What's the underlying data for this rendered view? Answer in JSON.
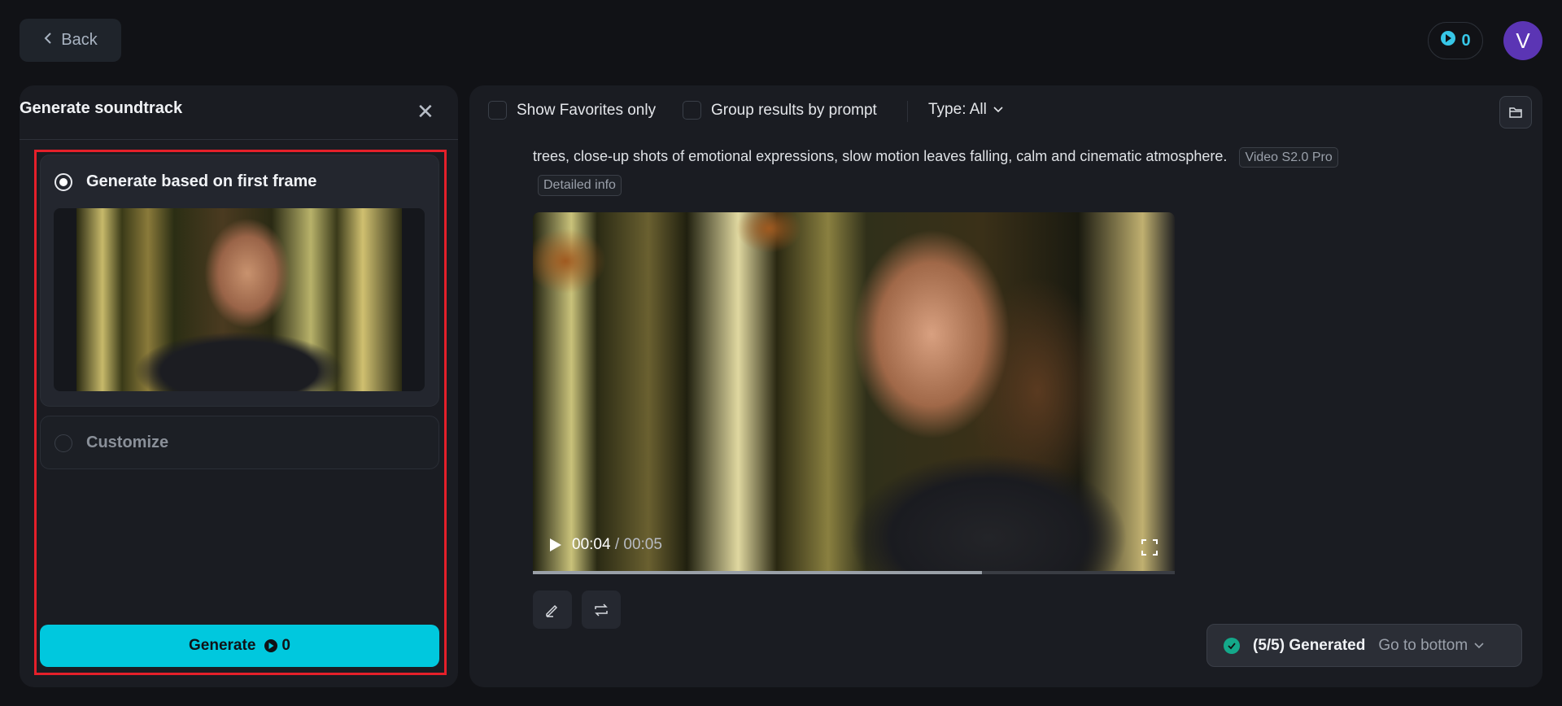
{
  "header": {
    "back_label": "Back",
    "credits": "0",
    "avatar_letter": "V"
  },
  "left_panel": {
    "title": "Generate soundtrack",
    "options": [
      {
        "label": "Generate based on first frame",
        "selected": true
      },
      {
        "label": "Customize",
        "selected": false
      }
    ],
    "generate_label": "Generate",
    "generate_cost": "0"
  },
  "toolbar": {
    "favorites_label": "Show Favorites only",
    "group_label": "Group results by prompt",
    "type_label": "Type: All"
  },
  "result": {
    "prompt": "trees, close-up shots of emotional expressions, slow motion leaves falling, calm and cinematic atmosphere.",
    "model_tag": "Video S2.0 Pro",
    "detail_label": "Detailed info",
    "current_time": "00:04",
    "duration": "/ 00:05",
    "progress": 0.7
  },
  "status": {
    "generated": "(5/5) Generated",
    "goto": "Go to bottom"
  },
  "colors": {
    "accent": "#00c8de",
    "avatar": "#5b35b4",
    "success": "#14a88a"
  }
}
